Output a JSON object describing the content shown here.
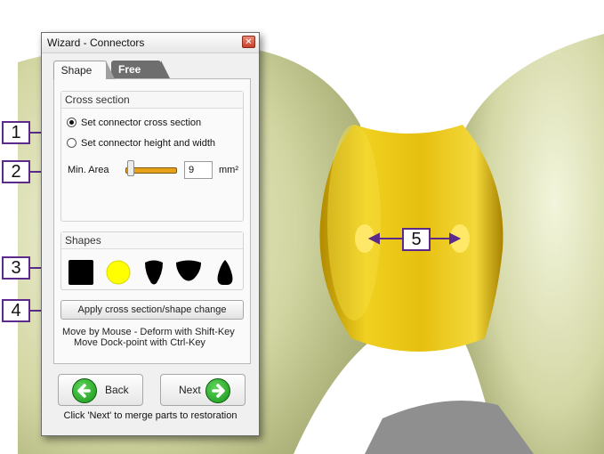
{
  "window": {
    "title": "Wizard - Connectors",
    "close_glyph": "✕"
  },
  "tabs": [
    {
      "label": "Shape",
      "active": true
    },
    {
      "label": "Free",
      "active": false
    }
  ],
  "cross_section": {
    "title": "Cross section",
    "options": [
      {
        "label": "Set connector cross section",
        "selected": true
      },
      {
        "label": "Set connector height and width",
        "selected": false
      }
    ],
    "min_area": {
      "label": "Min. Area",
      "value": "9",
      "unit": "mm²"
    }
  },
  "shapes": {
    "title": "Shapes",
    "items": [
      {
        "name": "square-shape-icon",
        "color": "#000000"
      },
      {
        "name": "circle-shape-icon",
        "color": "#ffff00"
      },
      {
        "name": "drop-shape-icon",
        "color": "#000000"
      },
      {
        "name": "half-circle-shape-icon",
        "color": "#000000"
      },
      {
        "name": "teardrop-shape-icon",
        "color": "#000000"
      }
    ]
  },
  "apply_button": "Apply cross section/shape change",
  "hints": [
    "Move by Mouse - Deform with Shift-Key",
    "Move Dock-point with Ctrl-Key"
  ],
  "nav": {
    "back_label": "Back",
    "next_label": "Next",
    "footer": "Click 'Next' to merge parts to restoration"
  },
  "callouts": [
    "1",
    "2",
    "3",
    "4",
    "5"
  ],
  "colors": {
    "callout_purple": "#5b2a8a",
    "connector_yellow": "#e8c010",
    "tooth_green": "#d8dca8",
    "slider_orange": "#e8a21a",
    "button_green": "#1aa01e"
  }
}
